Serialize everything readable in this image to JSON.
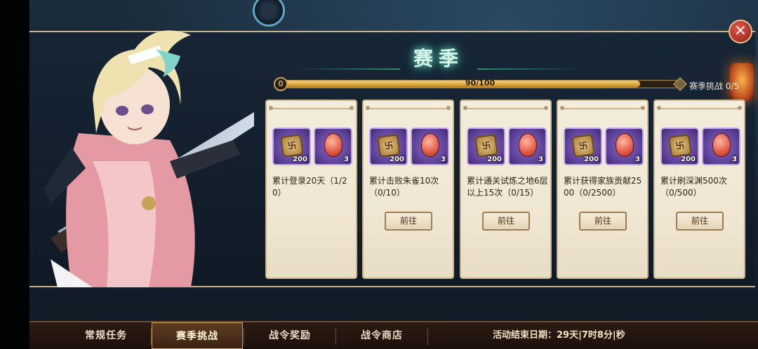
{
  "title": "赛季",
  "progress": {
    "start_label": "0",
    "text": "90/100",
    "value": 90,
    "max": 100
  },
  "challenge_label": "赛季挑战 0/5",
  "rewards": {
    "coin_glyph": "卐",
    "coin_qty": "200",
    "egg_qty": "3"
  },
  "cards": [
    {
      "task": "累计登录20天（1/20）",
      "has_go": false
    },
    {
      "task": "累计击败朱雀10次（0/10）",
      "has_go": true,
      "go_label": "前往"
    },
    {
      "task": "累计通关试炼之地6层以上15次（0/15）",
      "has_go": true,
      "go_label": "前往"
    },
    {
      "task": "累计获得家族贡献2500（0/2500）",
      "has_go": true,
      "go_label": "前往"
    },
    {
      "task": "累计刷深渊500次（0/500）",
      "has_go": true,
      "go_label": "前往"
    }
  ],
  "tabs": [
    {
      "label": "常规任务",
      "active": false
    },
    {
      "label": "赛季挑战",
      "active": true
    },
    {
      "label": "战令奖励",
      "active": false
    },
    {
      "label": "战令商店",
      "active": false
    }
  ],
  "end_date": "活动结束日期：29天|7时8分|秒",
  "close_glyph": "×",
  "colors": {
    "accent": "#c9a25a",
    "title_glow": "#5fd1b0",
    "close_red": "#e2574a"
  }
}
